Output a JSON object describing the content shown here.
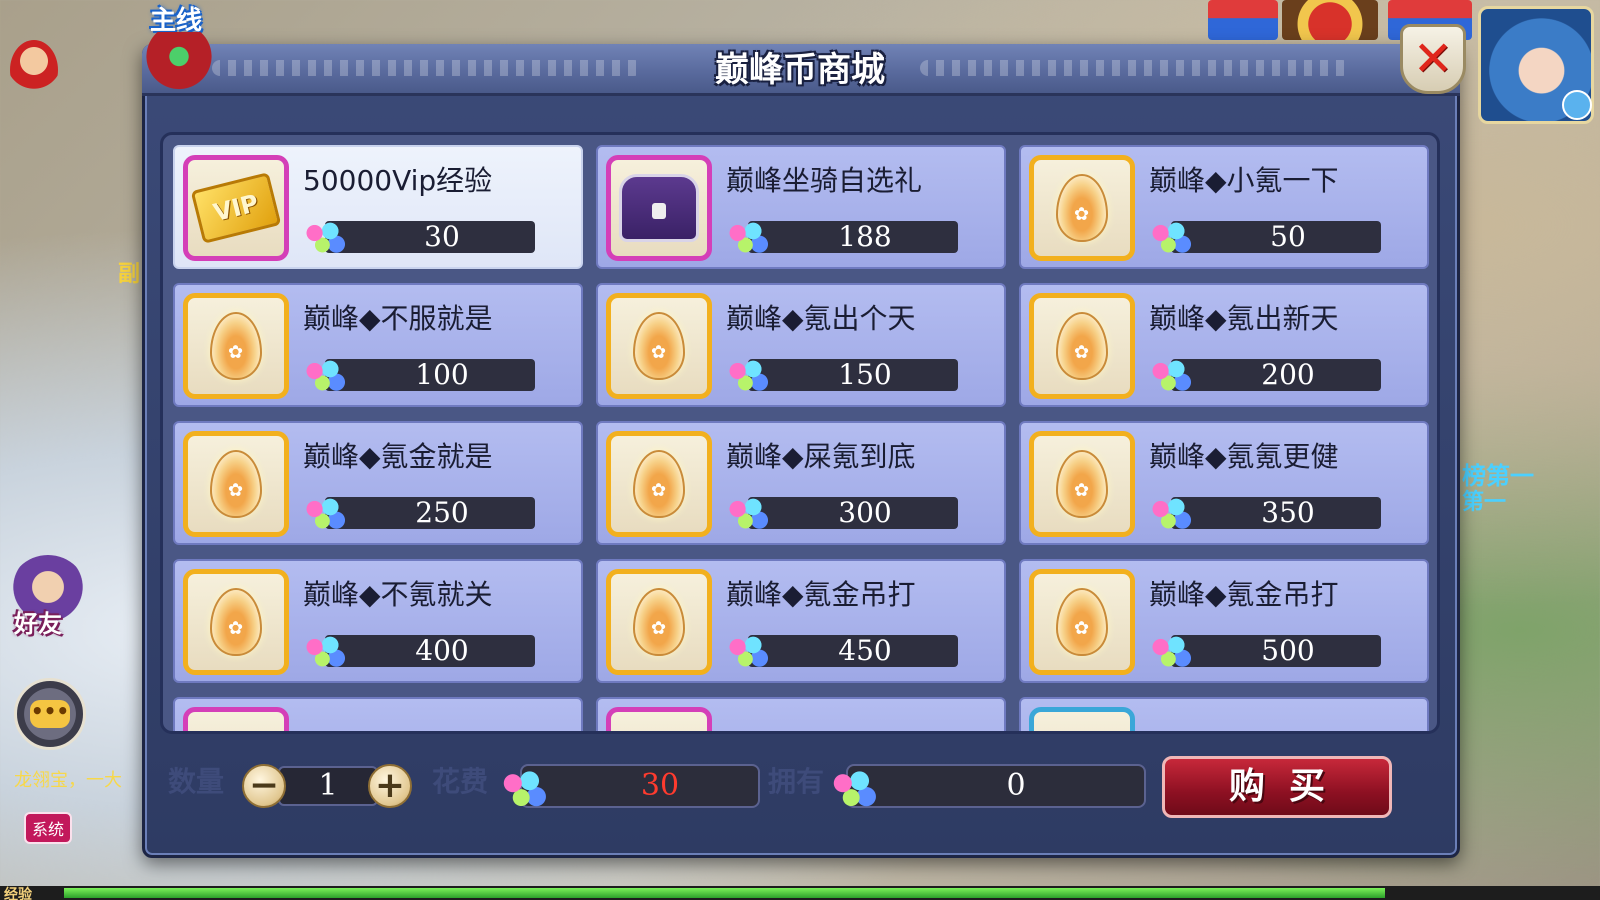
{
  "hud": {
    "quest_tag": "主线",
    "side_dungeon": "副",
    "friend_label": "好友",
    "chat_icon_glyph": "•••",
    "system_chat_text": "龙翎宝，一大",
    "system_badge": "系统",
    "exp_label": "经验",
    "exp_fraction": 0.86,
    "rank_text_1": "榜第一",
    "rank_text_2": "第一"
  },
  "shop": {
    "title": "巅峰币商城",
    "close_glyph": "✕",
    "items": [
      {
        "name": "50000Vip经验",
        "price": "30",
        "icon": "vip-card-icon",
        "frame": "purple",
        "selected": true
      },
      {
        "name": "巅峰坐骑自选礼",
        "price": "188",
        "icon": "treasure-chest-icon",
        "frame": "purple",
        "selected": false
      },
      {
        "name": "巅峰◆小氪一下",
        "price": "50",
        "icon": "egg-icon",
        "frame": "gold",
        "selected": false
      },
      {
        "name": "巅峰◆不服就是",
        "price": "100",
        "icon": "egg-icon",
        "frame": "gold",
        "selected": false
      },
      {
        "name": "巅峰◆氪出个天",
        "price": "150",
        "icon": "egg-icon",
        "frame": "gold",
        "selected": false
      },
      {
        "name": "巅峰◆氪出新天",
        "price": "200",
        "icon": "egg-icon",
        "frame": "gold",
        "selected": false
      },
      {
        "name": "巅峰◆氪金就是",
        "price": "250",
        "icon": "egg-icon",
        "frame": "gold",
        "selected": false
      },
      {
        "name": "巅峰◆屎氪到底",
        "price": "300",
        "icon": "egg-icon",
        "frame": "gold",
        "selected": false
      },
      {
        "name": "巅峰◆氪氪更健",
        "price": "350",
        "icon": "egg-icon",
        "frame": "gold",
        "selected": false
      },
      {
        "name": "巅峰◆不氪就关",
        "price": "400",
        "icon": "egg-icon",
        "frame": "gold",
        "selected": false
      },
      {
        "name": "巅峰◆氪金吊打",
        "price": "450",
        "icon": "egg-icon",
        "frame": "gold",
        "selected": false
      },
      {
        "name": "巅峰◆氪金吊打",
        "price": "500",
        "icon": "egg-icon",
        "frame": "gold",
        "selected": false
      }
    ],
    "partial_rows": [
      {
        "frame": "purple"
      },
      {
        "frame": "purple"
      },
      {
        "frame": "blue"
      }
    ],
    "purchase": {
      "qty_label": "数量",
      "qty_value": "1",
      "minus_glyph": "−",
      "plus_glyph": "+",
      "cost_label": "花费",
      "cost_value": "30",
      "own_label": "拥有",
      "own_value": "0",
      "buy_label": "购买"
    }
  },
  "colors": {
    "panel_bg": "#3b4a78",
    "item_bg": "#b3bcf0",
    "selected_item_bg": "#eef3fc",
    "gold_frame": "#f2b01e",
    "purple_frame": "#d43fb8",
    "blue_frame": "#3aa7d8",
    "buy_button": "#c7283a",
    "cost_text": "#ff3b2e"
  }
}
